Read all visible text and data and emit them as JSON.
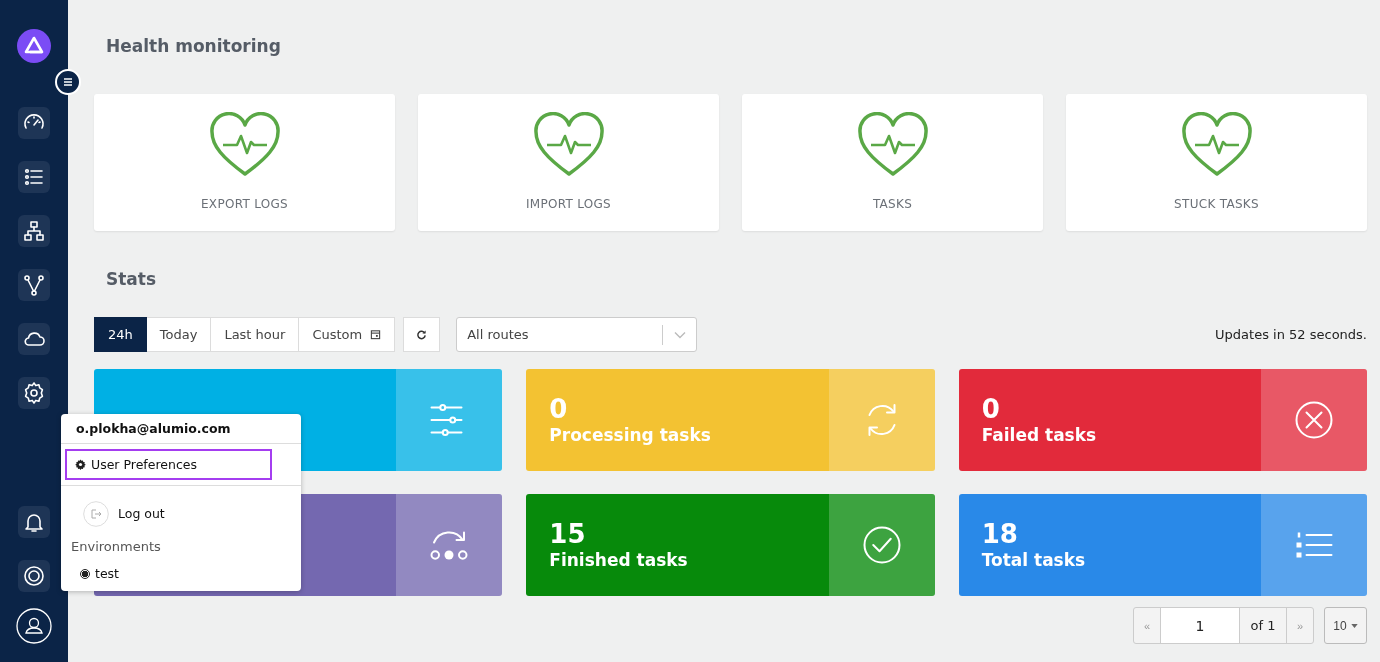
{
  "sidebar": {
    "items": [
      {
        "kind": "gauge"
      },
      {
        "kind": "list"
      },
      {
        "kind": "hierarchy"
      },
      {
        "kind": "branch"
      },
      {
        "kind": "cloud"
      },
      {
        "kind": "gear"
      }
    ],
    "bottom_items": [
      {
        "kind": "bell"
      },
      {
        "kind": "lifebuoy"
      }
    ]
  },
  "health": {
    "title": "Health monitoring",
    "cards": [
      {
        "label": "EXPORT LOGS"
      },
      {
        "label": "IMPORT LOGS"
      },
      {
        "label": "TASKS"
      },
      {
        "label": "STUCK TASKS"
      }
    ]
  },
  "stats": {
    "title": "Stats",
    "ranges": [
      {
        "label": "24h",
        "selected": true
      },
      {
        "label": "Today",
        "selected": false
      },
      {
        "label": "Last hour",
        "selected": false
      },
      {
        "label": "Custom",
        "selected": false,
        "kind": "calendar"
      }
    ],
    "route_select": {
      "value": "All routes"
    },
    "update_notice": "Updates in 52 seconds.",
    "cards": [
      {
        "kind": "sliders",
        "color": "#00b0e4"
      },
      {
        "kind": "cycle",
        "color": "#f3c232",
        "value": "0",
        "label": "Processing tasks"
      },
      {
        "kind": "cancel",
        "color": "#e22a3b",
        "value": "0",
        "label": "Failed tasks"
      },
      {
        "kind": "progress",
        "color": "#7468b0"
      },
      {
        "kind": "check",
        "color": "#078a0b",
        "value": "15",
        "label": "Finished tasks"
      },
      {
        "kind": "list",
        "color": "#2989e8",
        "value": "18",
        "label": "Total tasks"
      }
    ]
  },
  "pagination": {
    "previous": "«",
    "page": "1",
    "of": "of 1",
    "next": "»",
    "page_size": "10"
  },
  "user_menu": {
    "email": "o.plokha@alumio.com",
    "items": [
      {
        "kind": "gear",
        "label": "User Preferences",
        "focused": true
      },
      {
        "kind": "logout",
        "label": "Log out",
        "focused": false
      }
    ],
    "section": "Environments",
    "environments": [
      {
        "name": "test",
        "selected": true
      }
    ]
  }
}
